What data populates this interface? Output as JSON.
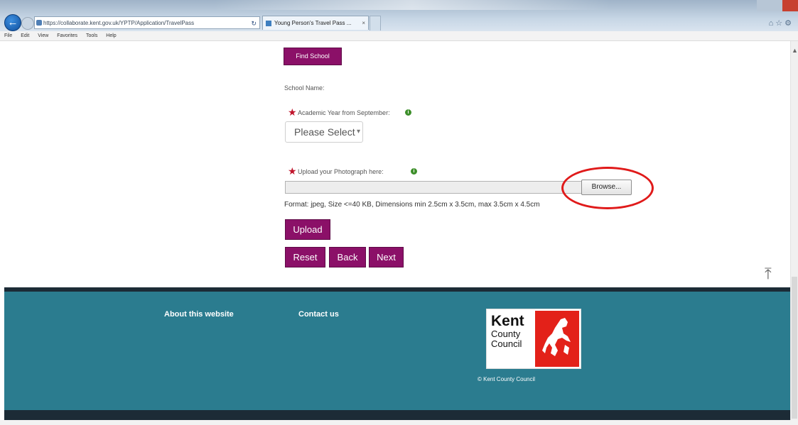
{
  "browser": {
    "address_url": "https://collaborate.kent.gov.uk/YPTP/Application/TravelPass",
    "tab_title": "Young Person's Travel Pass ...",
    "menu": [
      "File",
      "Edit",
      "View",
      "Favorites",
      "Tools",
      "Help"
    ]
  },
  "form": {
    "find_school_label": "Find School",
    "school_name_label": "School Name:",
    "academic_year_label": "Academic Year from September:",
    "academic_year_selected": "Please Select",
    "upload_photo_label": "Upload your Photograph here:",
    "browse_label": "Browse...",
    "format_text": "Format: jpeg, Size <=40 KB, Dimensions min 2.5cm x 3.5cm, max 3.5cm x 4.5cm",
    "upload_label": "Upload",
    "reset_label": "Reset",
    "back_label": "Back",
    "next_label": "Next"
  },
  "footer": {
    "about_link": "About this website",
    "contact_link": "Contact us",
    "logo_line1": "Kent",
    "logo_line2": "County",
    "logo_line3": "Council",
    "copyright": "© Kent County Council"
  },
  "colors": {
    "button_purple": "#8b1068",
    "footer_teal": "#2b7c8f",
    "annotation_red": "#e01a1a",
    "logo_red": "#e32119"
  }
}
